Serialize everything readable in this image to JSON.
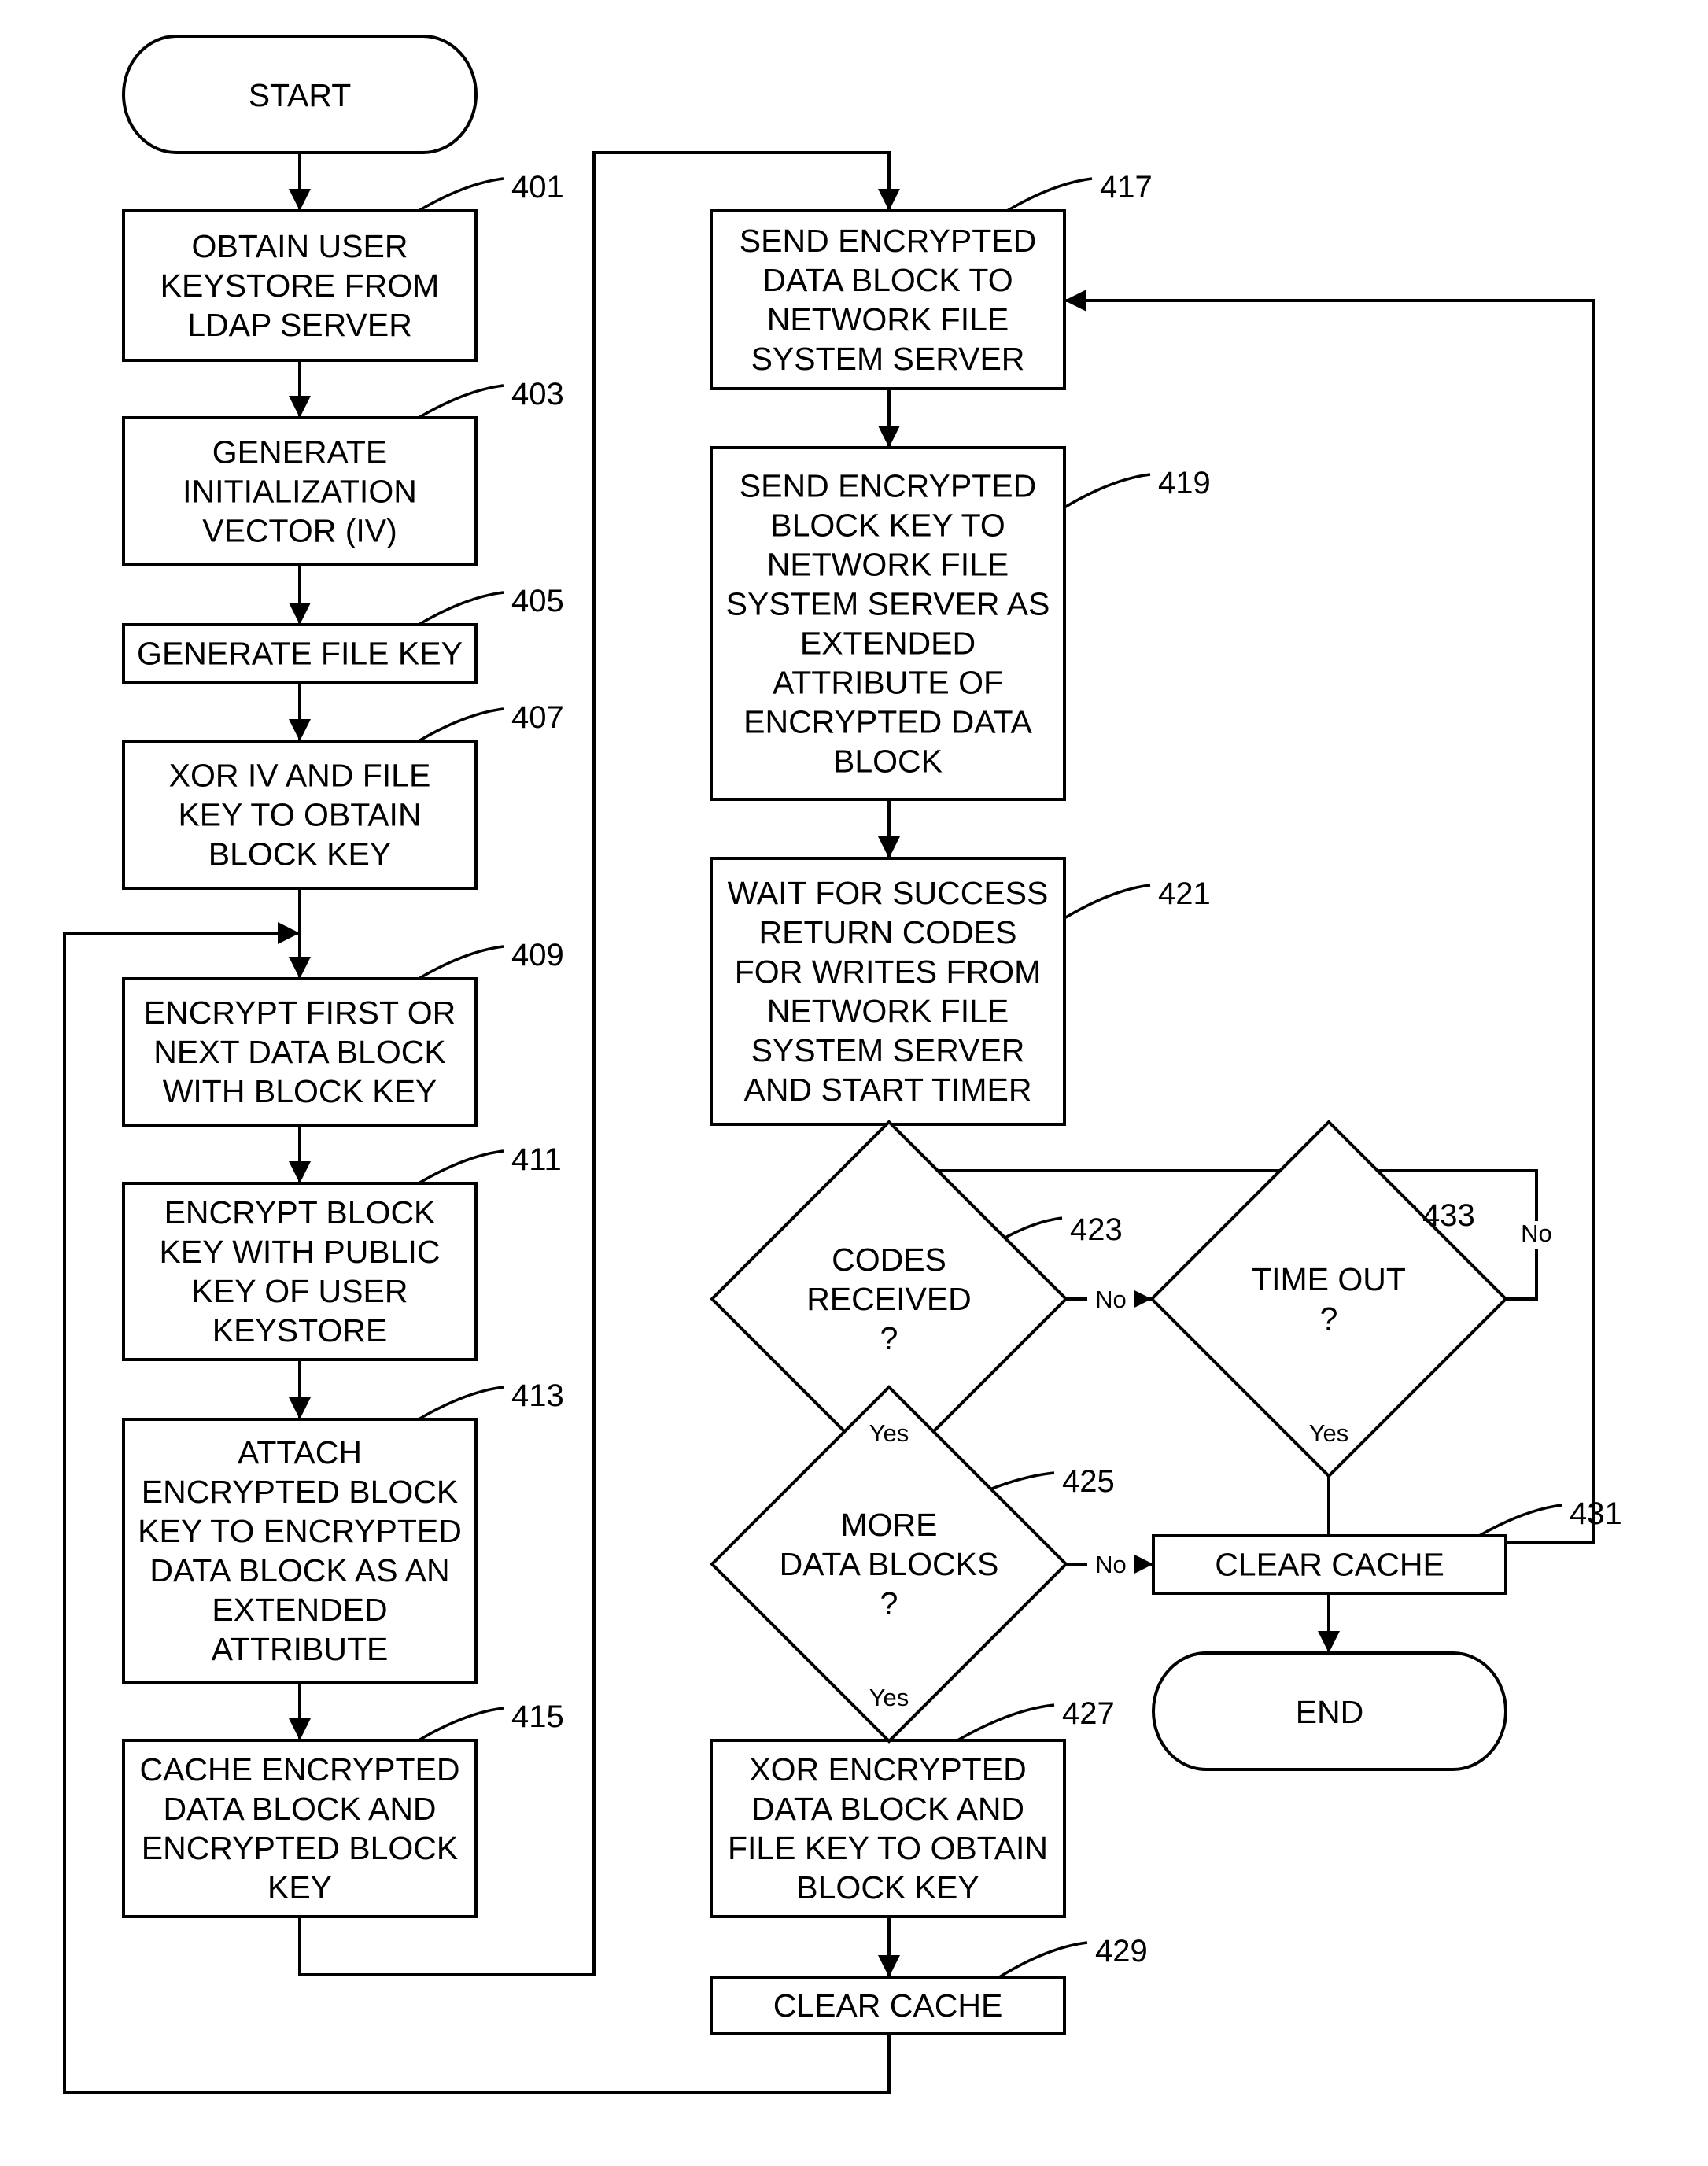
{
  "diagram": {
    "type": "flowchart",
    "terminals": {
      "start": "START",
      "end": "END"
    },
    "steps": [
      {
        "id": "401",
        "lines": [
          "OBTAIN USER",
          "KEYSTORE FROM",
          "LDAP SERVER"
        ]
      },
      {
        "id": "403",
        "lines": [
          "GENERATE",
          "INITIALIZATION",
          "VECTOR (IV)"
        ]
      },
      {
        "id": "405",
        "lines": [
          "GENERATE FILE KEY"
        ]
      },
      {
        "id": "407",
        "lines": [
          "XOR IV AND FILE",
          "KEY TO OBTAIN",
          "BLOCK KEY"
        ]
      },
      {
        "id": "409",
        "lines": [
          "ENCRYPT FIRST OR",
          "NEXT DATA BLOCK",
          "WITH BLOCK KEY"
        ]
      },
      {
        "id": "411",
        "lines": [
          "ENCRYPT BLOCK",
          "KEY WITH PUBLIC",
          "KEY OF USER",
          "KEYSTORE"
        ]
      },
      {
        "id": "413",
        "lines": [
          "ATTACH",
          "ENCRYPTED BLOCK",
          "KEY TO ENCRYPTED",
          "DATA BLOCK AS AN",
          "EXTENDED",
          "ATTRIBUTE"
        ]
      },
      {
        "id": "415",
        "lines": [
          "CACHE ENCRYPTED",
          "DATA BLOCK AND",
          "ENCRYPTED BLOCK",
          "KEY"
        ]
      },
      {
        "id": "417",
        "lines": [
          "SEND ENCRYPTED",
          "DATA BLOCK TO",
          "NETWORK FILE",
          "SYSTEM SERVER"
        ]
      },
      {
        "id": "419",
        "lines": [
          "SEND ENCRYPTED",
          "BLOCK KEY TO",
          "NETWORK FILE",
          "SYSTEM SERVER AS",
          "EXTENDED",
          "ATTRIBUTE OF",
          "ENCRYPTED DATA",
          "BLOCK"
        ]
      },
      {
        "id": "421",
        "lines": [
          "WAIT FOR SUCCESS",
          "RETURN CODES",
          "FOR WRITES FROM",
          "NETWORK FILE",
          "SYSTEM SERVER",
          "AND START TIMER"
        ]
      },
      {
        "id": "427",
        "lines": [
          "XOR ENCRYPTED",
          "DATA BLOCK AND",
          "FILE KEY TO OBTAIN",
          "BLOCK KEY"
        ]
      },
      {
        "id": "429",
        "lines": [
          "CLEAR CACHE"
        ]
      },
      {
        "id": "431",
        "lines": [
          "CLEAR CACHE"
        ]
      }
    ],
    "decisions": [
      {
        "id": "423",
        "lines": [
          "CODES",
          "RECEIVED",
          "?"
        ],
        "yes": "425",
        "no": "433"
      },
      {
        "id": "425",
        "lines": [
          "MORE",
          "DATA BLOCKS",
          "?"
        ],
        "yes": "427",
        "no": "431"
      },
      {
        "id": "433",
        "lines": [
          "TIME OUT",
          "?"
        ],
        "yes": "417",
        "no": "423"
      }
    ],
    "branch_labels": {
      "yes": "Yes",
      "no": "No"
    },
    "edges": [
      [
        "START",
        "401"
      ],
      [
        "401",
        "403"
      ],
      [
        "403",
        "405"
      ],
      [
        "405",
        "407"
      ],
      [
        "407",
        "409"
      ],
      [
        "409",
        "411"
      ],
      [
        "411",
        "413"
      ],
      [
        "413",
        "415"
      ],
      [
        "415",
        "417"
      ],
      [
        "417",
        "419"
      ],
      [
        "419",
        "421"
      ],
      [
        "421",
        "423"
      ],
      [
        "423",
        "425",
        "Yes"
      ],
      [
        "423",
        "433",
        "No"
      ],
      [
        "433",
        "423",
        "No"
      ],
      [
        "433",
        "417",
        "Yes"
      ],
      [
        "425",
        "427",
        "Yes"
      ],
      [
        "425",
        "431",
        "No"
      ],
      [
        "427",
        "429"
      ],
      [
        "429",
        "409"
      ],
      [
        "431",
        "END"
      ]
    ]
  }
}
